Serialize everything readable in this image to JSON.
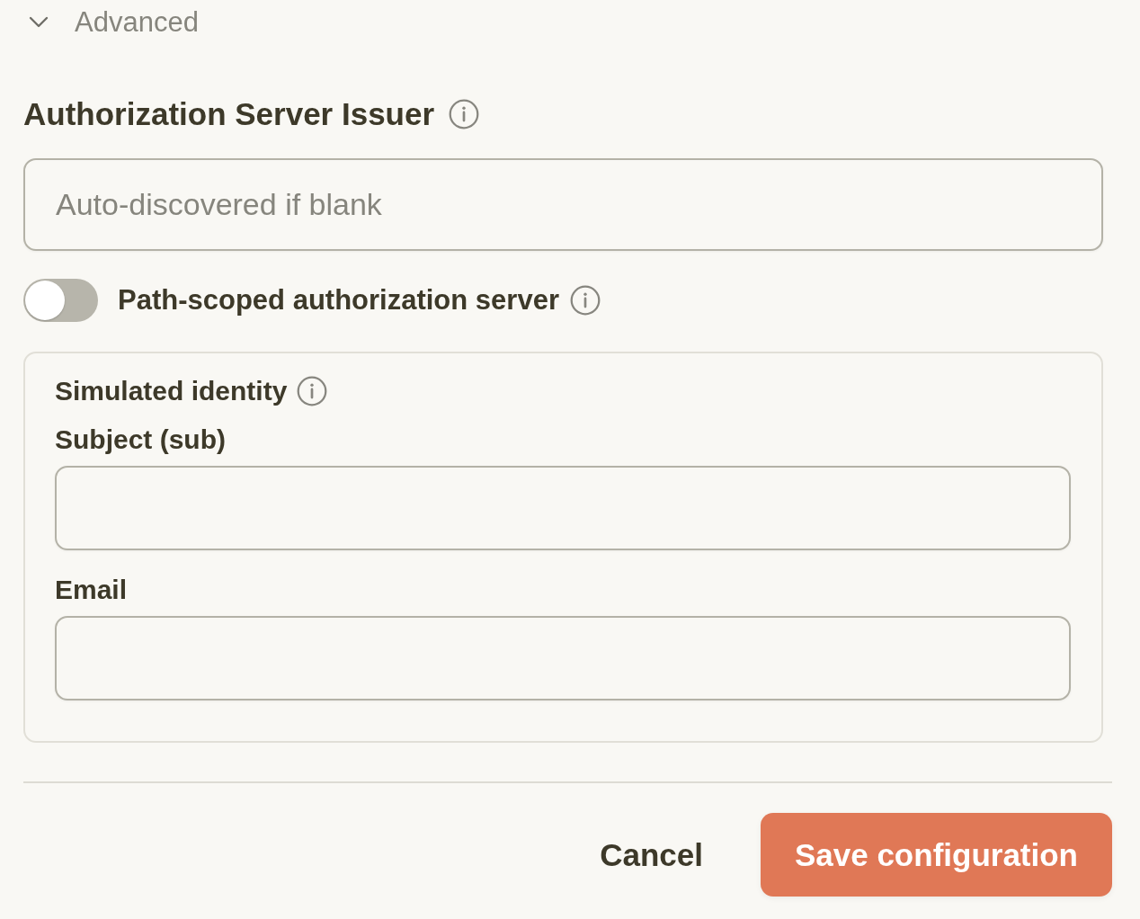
{
  "advanced": {
    "label": "Advanced",
    "expanded": true
  },
  "issuer": {
    "label": "Authorization Server Issuer",
    "placeholder": "Auto-discovered if blank"
  },
  "path_scoped": {
    "label": "Path-scoped authorization server",
    "on": false
  },
  "simulated_identity": {
    "title": "Simulated identity",
    "fields": [
      {
        "label": "Subject (sub)"
      },
      {
        "label": "Email"
      }
    ]
  },
  "buttons": [
    {
      "label": "Cancel",
      "kind": "text"
    },
    {
      "label": "Save configuration",
      "kind": "primary"
    }
  ]
}
